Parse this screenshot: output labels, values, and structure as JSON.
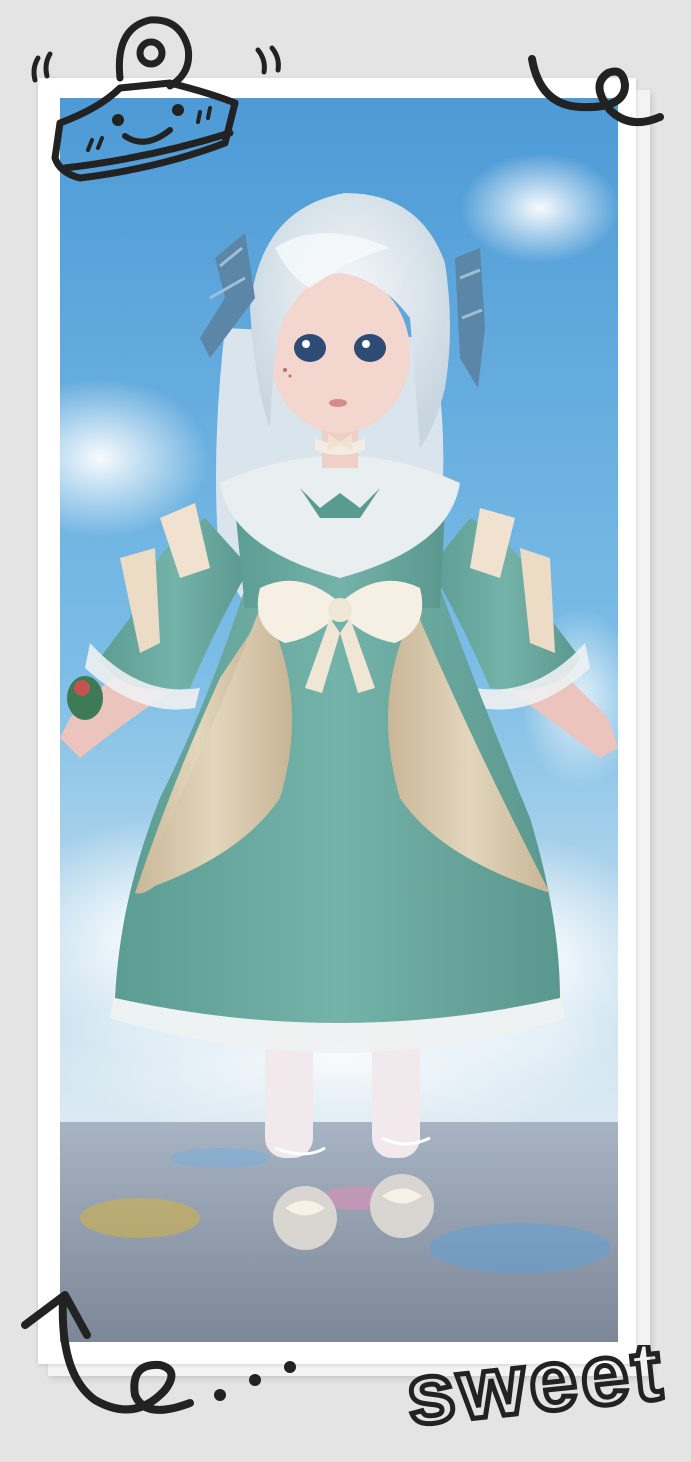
{
  "caption": "sweet",
  "colors": {
    "sky": "#6fb3e0",
    "dress": "#6aa9a0",
    "apron": "#d8c9ad",
    "hair": "#e6eef3",
    "ink": "#222222"
  }
}
